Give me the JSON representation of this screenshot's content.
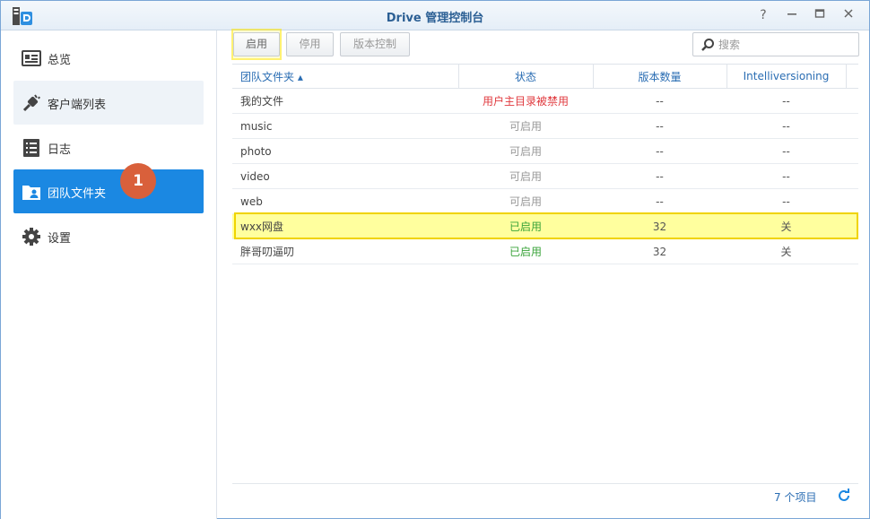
{
  "window": {
    "title": "Drive 管理控制台",
    "help": "?",
    "minimize": "–",
    "maximize": "□",
    "close": "✕"
  },
  "sidebar": {
    "items": [
      {
        "label": "总览",
        "icon": "overview-icon"
      },
      {
        "label": "客户端列表",
        "icon": "client-list-icon"
      },
      {
        "label": "日志",
        "icon": "log-icon"
      },
      {
        "label": "团队文件夹",
        "icon": "team-folder-icon"
      },
      {
        "label": "设置",
        "icon": "gear-icon"
      }
    ],
    "active_index": 3
  },
  "annotation": {
    "badge": "1"
  },
  "toolbar": {
    "enable_label": "启用",
    "disable_label": "停用",
    "version_label": "版本控制"
  },
  "search": {
    "placeholder": "搜索"
  },
  "table": {
    "headers": [
      "团队文件夹 ▴",
      "状态",
      "版本数量",
      "Intelliversioning"
    ],
    "rows": [
      {
        "name": "我的文件",
        "status": "用户主目录被禁用",
        "versions": "--",
        "intelli": "--"
      },
      {
        "name": "music",
        "status": "可启用",
        "versions": "--",
        "intelli": "--"
      },
      {
        "name": "photo",
        "status": "可启用",
        "versions": "--",
        "intelli": "--"
      },
      {
        "name": "video",
        "status": "可启用",
        "versions": "--",
        "intelli": "--"
      },
      {
        "name": "web",
        "status": "可启用",
        "versions": "--",
        "intelli": "--"
      },
      {
        "name": "wxx网盘",
        "status": "已启用",
        "versions": "32",
        "intelli": "关"
      },
      {
        "name": "胖哥叨逼叨",
        "status": "已启用",
        "versions": "32",
        "intelli": "关"
      }
    ]
  },
  "footer": {
    "count": "7 个项目"
  },
  "colors": {
    "accent": "#1b88e2",
    "header_text": "#2a6db3",
    "enabled": "#3aa33a",
    "disabled_warning": "#e0393e",
    "highlight": "#ffff9e"
  }
}
